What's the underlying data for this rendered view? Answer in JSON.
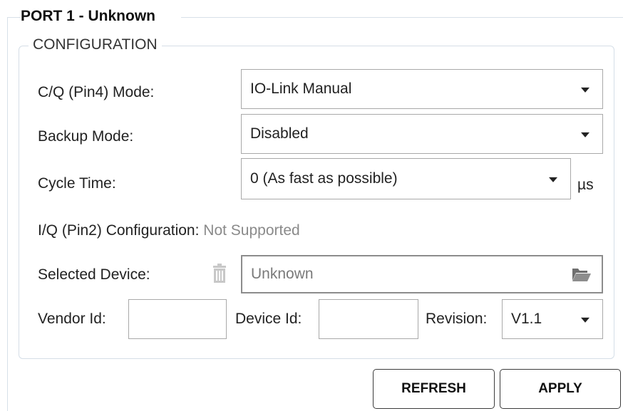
{
  "port": {
    "title": "PORT 1 - Unknown"
  },
  "configuration": {
    "title": "CONFIGURATION",
    "cq_mode": {
      "label": "C/Q (Pin4) Mode:",
      "value": "IO-Link Manual"
    },
    "backup_mode": {
      "label": "Backup Mode:",
      "value": "Disabled"
    },
    "cycle_time": {
      "label": "Cycle Time:",
      "value": "0 (As fast as possible)",
      "unit": "µs"
    },
    "iq_config": {
      "label": "I/Q (Pin2) Configuration:",
      "value": "Not Supported"
    },
    "selected_device": {
      "label": "Selected Device:",
      "value": "Unknown",
      "delete_icon": "trash-icon",
      "browse_icon": "folder-open-icon"
    },
    "vendor_id": {
      "label": "Vendor Id:",
      "value": ""
    },
    "device_id": {
      "label": "Device Id:",
      "value": ""
    },
    "revision": {
      "label": "Revision:",
      "value": "V1.1"
    }
  },
  "buttons": {
    "refresh": "REFRESH",
    "apply": "APPLY"
  },
  "colors": {
    "group_border": "#d5dee7",
    "muted_text": "#8a8a8a",
    "field_border": "#a9a9a9"
  }
}
